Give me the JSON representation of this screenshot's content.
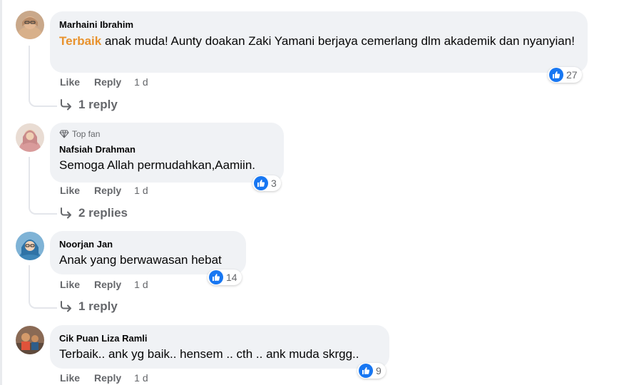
{
  "comments": [
    {
      "author": "Marhaini Ibrahim",
      "highlight": "Terbaik",
      "text": " anak muda! Aunty doakan Zaki Yamani berjaya cemerlang dlm akademik dan nyanyian!",
      "like_label": "Like",
      "reply_label": "Reply",
      "time": "1 d",
      "reactions": "27",
      "replies_label": "1 reply"
    },
    {
      "badge": "Top fan",
      "author": "Nafsiah Drahman",
      "text": "Semoga Allah permudahkan,Aamiin.",
      "like_label": "Like",
      "reply_label": "Reply",
      "time": "1 d",
      "reactions": "3",
      "replies_label": "2 replies"
    },
    {
      "author": "Noorjan Jan",
      "text": "Anak yang berwawasan hebat",
      "like_label": "Like",
      "reply_label": "Reply",
      "time": "1 d",
      "reactions": "14",
      "replies_label": "1 reply"
    },
    {
      "author": "Cik Puan Liza Ramli",
      "text": "Terbaik.. ank yg baik.. hensem .. cth .. ank muda skrgg..",
      "like_label": "Like",
      "reply_label": "Reply",
      "time": "1 d",
      "reactions": "9"
    }
  ],
  "icons": {
    "like": "thumbs-up-icon",
    "reply_arrow": "reply-arrow-icon",
    "top_fan": "diamond-icon"
  },
  "colors": {
    "bubble": "#f0f2f5",
    "like_blue": "#1877f2",
    "highlight": "#e8922d",
    "secondary_text": "#65676b"
  }
}
